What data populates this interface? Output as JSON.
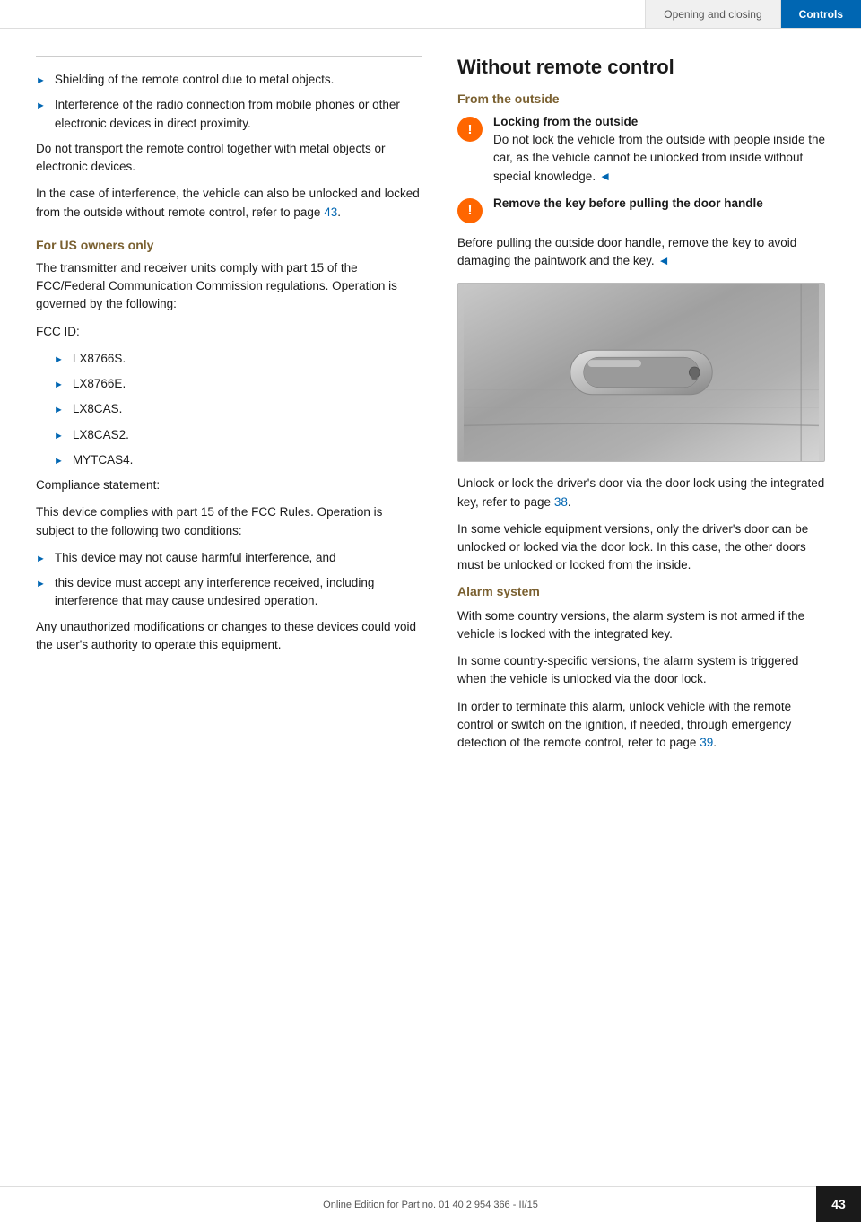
{
  "header": {
    "tab1_label": "Opening and closing",
    "tab2_label": "Controls"
  },
  "left_column": {
    "bullet1": "Shielding of the remote control due to metal objects.",
    "bullet2": "Interference of the radio connection from mobile phones or other electronic devices in direct proximity.",
    "para1": "Do not transport the remote control together with metal objects or electronic devices.",
    "para2": "In the case of interference, the vehicle can also be unlocked and locked from the outside without remote control, refer to page",
    "para2_link": "43",
    "para2_end": ".",
    "for_us_heading": "For US owners only",
    "for_us_para1": "The transmitter and receiver units comply with part 15 of the FCC/Federal Communication Commission regulations. Operation is governed by the following:",
    "fcc_id_label": "FCC ID:",
    "fcc_items": [
      "LX8766S.",
      "LX8766E.",
      "LX8CAS.",
      "LX8CAS2.",
      "MYTCAS4."
    ],
    "compliance_label": "Compliance statement:",
    "compliance_para": "This device complies with part 15 of the FCC Rules. Operation is subject to the following two conditions:",
    "compliance_bullet1": "This device may not cause harmful interference, and",
    "compliance_bullet2": "this device must accept any interference received, including interference that may cause undesired operation.",
    "unauthorized_para": "Any unauthorized modifications or changes to these devices could void the user's authority to operate this equipment."
  },
  "right_column": {
    "main_title": "Without remote control",
    "from_outside_heading": "From the outside",
    "warning1_title": "Locking from the outside",
    "warning1_text": "Do not lock the vehicle from the outside with people inside the car, as the vehicle cannot be unlocked from inside without special knowledge.",
    "warning1_endmark": "◄",
    "warning2_title": "Remove the key before pulling the door handle",
    "para_door1": "Before pulling the outside door handle, remove the key to avoid damaging the paintwork and the key.",
    "para_door1_endmark": "◄",
    "para_door2": "Unlock or lock the driver's door via the door lock using the integrated key, refer to page",
    "para_door2_link": "38",
    "para_door2_end": ".",
    "para_door3": "In some vehicle equipment versions, only the driver's door can be unlocked or locked via the door lock. In this case, the other doors must be unlocked or locked from the inside.",
    "alarm_heading": "Alarm system",
    "alarm_para1": "With some country versions, the alarm system is not armed if the vehicle is locked with the integrated key.",
    "alarm_para2": "In some country-specific versions, the alarm system is triggered when the vehicle is unlocked via the door lock.",
    "alarm_para3": "In order to terminate this alarm, unlock vehicle with the remote control or switch on the ignition, if needed, through emergency detection of the remote control, refer to page",
    "alarm_para3_link": "39",
    "alarm_para3_end": "."
  },
  "footer": {
    "text": "Online Edition for Part no. 01 40 2 954 366 - II/15",
    "page_number": "43"
  }
}
